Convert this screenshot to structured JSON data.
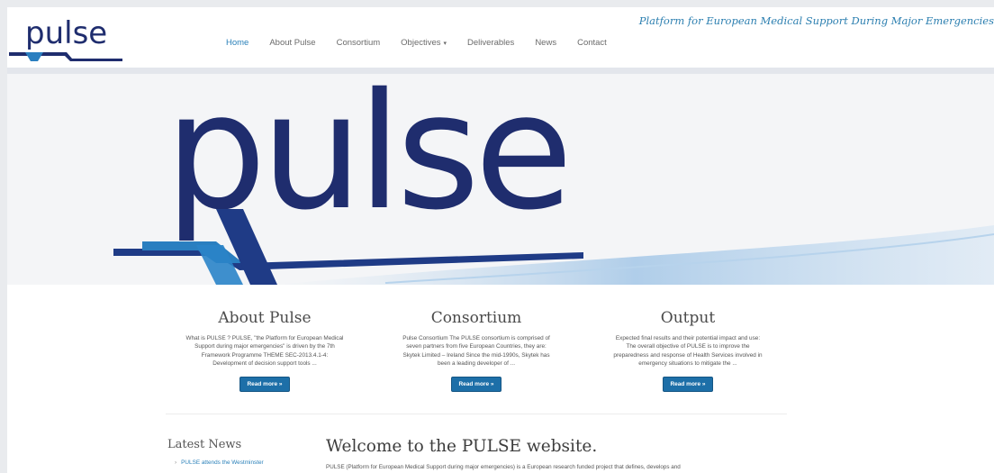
{
  "header": {
    "tagline": "Platform for European Medical Support During Major Emergencies",
    "nav": [
      {
        "label": "Home",
        "active": true
      },
      {
        "label": "About Pulse"
      },
      {
        "label": "Consortium"
      },
      {
        "label": "Objectives"
      },
      {
        "label": "Deliverables"
      },
      {
        "label": "News"
      },
      {
        "label": "Contact"
      }
    ],
    "objectives_caret": "▾"
  },
  "brand": {
    "logo_text": "pulse",
    "logo_color": "#1f2d6e",
    "accent_color": "#2a80b9"
  },
  "columns": [
    {
      "title": "About Pulse",
      "lines": [
        "What is PULSE ? PULSE, \"the Platform for European Medical",
        "Support during major emergencies\" is driven by the 7th",
        "Framework Programme THEME SEC-2013.4.1-4:",
        "Development of decision support tools ..."
      ],
      "button": "Read more »"
    },
    {
      "title": "Consortium",
      "lines": [
        "Pulse Consortium The PULSE consortium is comprised of",
        "seven partners from five European Countries, they are:",
        "Skytek Limited – Ireland Since the mid-1990s, Skytek has",
        "been a leading developer of ..."
      ],
      "button": "Read more »"
    },
    {
      "title": "Output",
      "lines": [
        "Expected final results and their potential impact and use:",
        "The overall objective of PULSE is to improve the",
        "preparedness and response of Health Services involved in",
        "emergency situations to mitigate the ..."
      ],
      "button": "Read more »"
    }
  ],
  "news": {
    "title": "Latest News",
    "items": [
      "PULSE attends the Westminster"
    ]
  },
  "welcome": {
    "title": "Welcome to the PULSE website.",
    "intro": "PULSE (Platform for European Medical Support during major emergencies) is a European research funded project that defines, develops and"
  }
}
